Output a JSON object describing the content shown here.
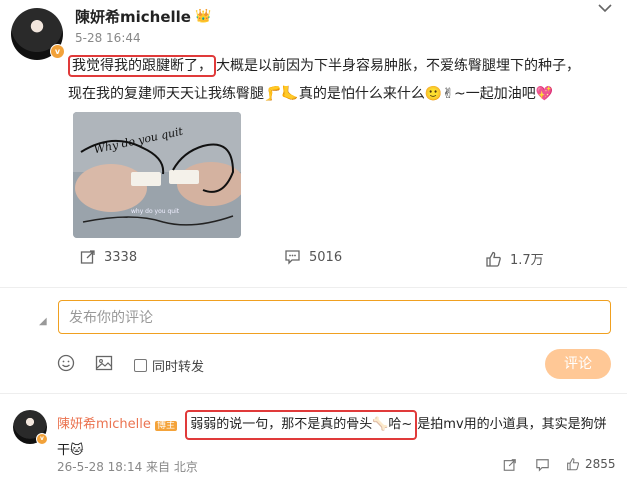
{
  "post": {
    "author": "陳妍希michelle",
    "author_badge_icon": "crown-icon",
    "time": "5-28 16:44",
    "text_highlight": "我觉得我的跟腱断了，",
    "text_line1_rest": "大概是以前因为下半身容易肿胀，不爱练臀腿埋下的种子，",
    "text_line2": "现在我的复建师天天让我练臀腿",
    "emoji_a": "🦵🦶",
    "text_line2_mid": "真的是怕什么来什么",
    "emoji_b": "🙂✌",
    "text_line2_end": "~一起加油吧",
    "emoji_c": "💖",
    "image_caption": "Why do you quit",
    "image_caption_small": "why do you quit"
  },
  "stats": {
    "reposts": "3338",
    "comments": "5016",
    "likes": "1.7万"
  },
  "composer": {
    "placeholder": "发布你的评论",
    "repost_label": "同时转发",
    "submit_label": "评论"
  },
  "comment": {
    "author": "陳妍希michelle",
    "badge": "博主",
    "text_highlight": "弱弱的说一句，那不是真的骨头",
    "bone_emoji": "🦴",
    "text_highlight_end": "哈~",
    "text_rest": "是拍mv用的小道具，其实是狗饼",
    "text_line2": "干",
    "emoji_dog": "🐱",
    "meta": "26-5-28 18:14 来自 北京",
    "likes": "2855"
  },
  "colors": {
    "highlight_border": "#e03a3a",
    "accent_orange": "#f0a020",
    "submit_bg": "#ffc896",
    "comment_name": "#eb7350"
  }
}
